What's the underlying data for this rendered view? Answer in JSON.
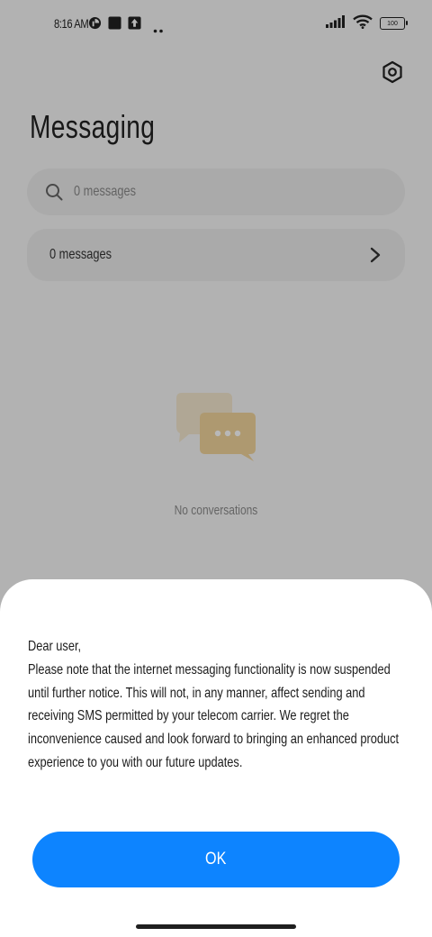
{
  "status_bar": {
    "time": "8:16 AM",
    "battery": "100"
  },
  "header": {
    "title": "Messaging"
  },
  "search": {
    "placeholder": "0 messages"
  },
  "list": {
    "row_label": "0 messages"
  },
  "empty_state": {
    "text": "No conversations"
  },
  "dialog": {
    "greeting": "Dear user,",
    "body": "Please note that the internet messaging functionality is now suspended until further notice. This will not, in any manner, affect sending and receiving SMS permitted by your telecom carrier. We regret the inconvenience caused and look forward to bringing an enhanced product experience to you with our future updates.",
    "ok_label": "OK"
  },
  "colors": {
    "accent": "#0d84ff",
    "illustration": "#f3dcae"
  },
  "icons": [
    "settings-icon",
    "search-icon",
    "chevron-right-icon",
    "chat-bubbles-icon",
    "signal-icon",
    "wifi-icon",
    "battery-icon"
  ]
}
